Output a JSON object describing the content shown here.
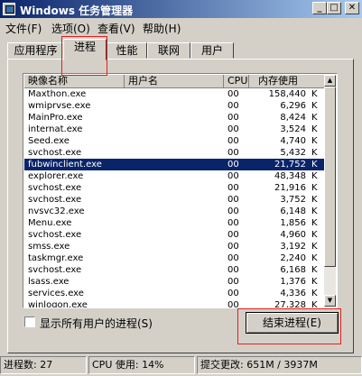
{
  "window": {
    "title": "Windows 任务管理器",
    "buttons": {
      "minimize": "_",
      "maximize": "□",
      "close": "✕"
    }
  },
  "menu": [
    "文件(F)",
    "选项(O)",
    "查看(V)",
    "帮助(H)"
  ],
  "tabs": [
    {
      "label": "应用程序",
      "active": false
    },
    {
      "label": "进程",
      "active": true
    },
    {
      "label": "性能",
      "active": false
    },
    {
      "label": "联网",
      "active": false
    },
    {
      "label": "用户",
      "active": false
    }
  ],
  "table": {
    "columns": {
      "image": "映像名称",
      "user": "用户名",
      "cpu": "CPU",
      "mem": "内存使用"
    },
    "mem_unit": "K",
    "rows": [
      {
        "name": "Maxthon.exe",
        "cpu": "00",
        "mem": "158,440"
      },
      {
        "name": "wmiprvse.exe",
        "cpu": "00",
        "mem": "6,296"
      },
      {
        "name": "MainPro.exe",
        "cpu": "00",
        "mem": "8,424"
      },
      {
        "name": "internat.exe",
        "cpu": "00",
        "mem": "3,524"
      },
      {
        "name": "Seed.exe",
        "cpu": "00",
        "mem": "4,740"
      },
      {
        "name": "svchost.exe",
        "cpu": "00",
        "mem": "5,432"
      },
      {
        "name": "fubwinclient.exe",
        "cpu": "00",
        "mem": "21,752",
        "selected": true
      },
      {
        "name": "explorer.exe",
        "cpu": "00",
        "mem": "48,348"
      },
      {
        "name": "svchost.exe",
        "cpu": "00",
        "mem": "21,916"
      },
      {
        "name": "svchost.exe",
        "cpu": "00",
        "mem": "3,752"
      },
      {
        "name": "nvsvc32.exe",
        "cpu": "00",
        "mem": "6,148"
      },
      {
        "name": "Menu.exe",
        "cpu": "00",
        "mem": "1,856"
      },
      {
        "name": "svchost.exe",
        "cpu": "00",
        "mem": "4,960"
      },
      {
        "name": "smss.exe",
        "cpu": "00",
        "mem": "3,192"
      },
      {
        "name": "taskmgr.exe",
        "cpu": "00",
        "mem": "2,240"
      },
      {
        "name": "svchost.exe",
        "cpu": "00",
        "mem": "6,168"
      },
      {
        "name": "lsass.exe",
        "cpu": "00",
        "mem": "1,376"
      },
      {
        "name": "services.exe",
        "cpu": "00",
        "mem": "4,336"
      },
      {
        "name": "winlogon.exe",
        "cpu": "00",
        "mem": "27,328"
      }
    ]
  },
  "show_all_label": "显示所有用户的进程(S)",
  "end_process_label": "结束进程(E)",
  "status": {
    "processes": "进程数: 27",
    "cpu": "CPU 使用: 14%",
    "commit": "提交更改: 651M / 3937M"
  },
  "colors": {
    "selection": "#0a246a",
    "annotation": "#e02020"
  }
}
